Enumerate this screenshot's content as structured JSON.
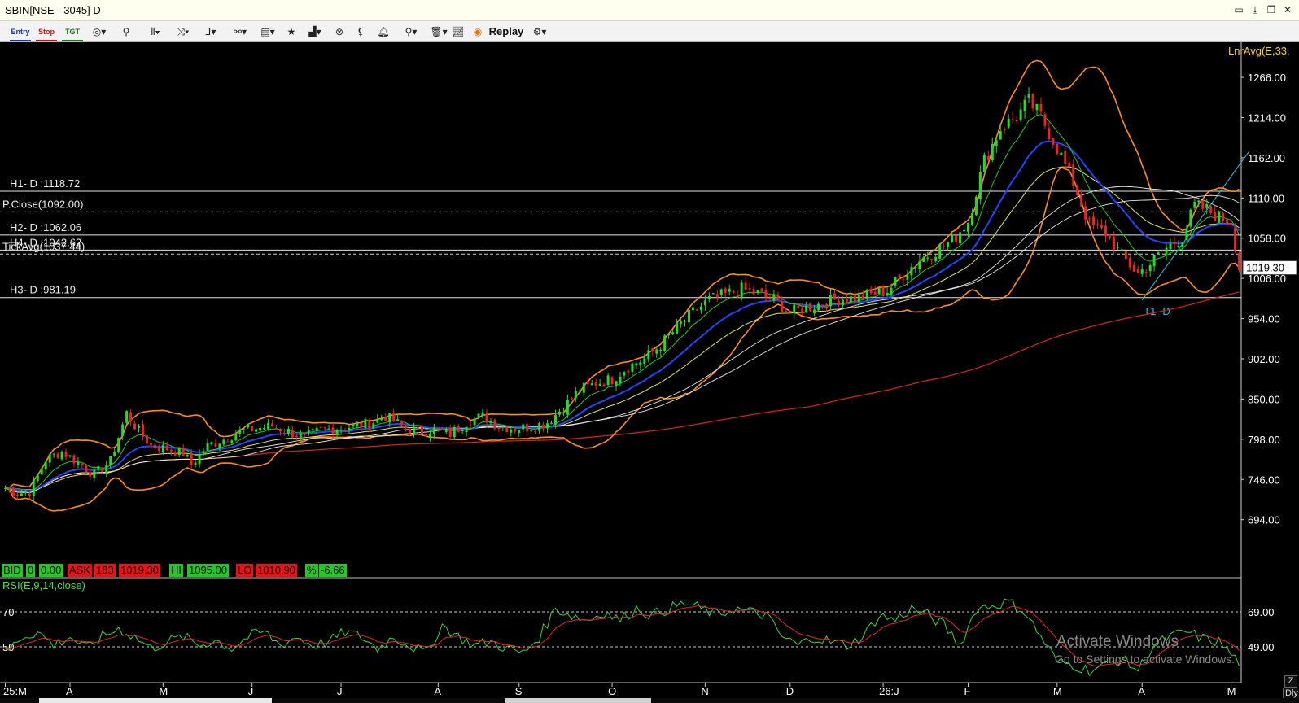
{
  "window": {
    "title": "SBIN[NSE - 3045] D",
    "controls": [
      "▭",
      "✕"
    ]
  },
  "toolbar": {
    "entry": "Entry",
    "stop": "Stop",
    "tgt": "TGT",
    "replay": "Replay"
  },
  "quote": {
    "bid_label": "BID",
    "bid_qty": "0",
    "bid_price": "0.00",
    "ask_label": "ASK",
    "ask_qty": "183",
    "ask_price": "1019.30",
    "hi_label": "HI",
    "hi": "1095.00",
    "lo_label": "LO",
    "lo": "1010.90",
    "pct_label": "%",
    "pct": "-6.66"
  },
  "rsi": {
    "label": "RSI(E,9,14,close)",
    "left_levels": [
      "70",
      "50"
    ],
    "right_levels": [
      "69.00",
      "49.00"
    ]
  },
  "watermark": {
    "line1": "Activate Windows",
    "line2": "Go to Settings to activate Windows."
  },
  "corner_buttons": {
    "zoom": "Z",
    "period": "Dly"
  },
  "colors": {
    "background": "#000000",
    "up_candle": "#22dd22",
    "down_candle": "#ee2222",
    "bollinger": "#ff8c1a",
    "ema_green": "#22cc22",
    "ema_blue": "#2244ff",
    "ema_yellow": "#e6e64d",
    "ma_white": "#e8e8e8",
    "ma_red": "#dd2222",
    "rsi_line": "#33dd33",
    "rsi_signal": "#ee2222",
    "trendline": "#1ec8e6"
  },
  "chart_data": {
    "type": "candlestick",
    "symbol": "SBIN[NSE - 3045] D",
    "top_legend": "LnrAvg(E,33,",
    "ylim": [
      640,
      1305
    ],
    "y_ticks": [
      "1266.00",
      "1214.00",
      "1162.00",
      "1110.00",
      "1058.00",
      "1006.00",
      "954.00",
      "902.00",
      "850.00",
      "798.00",
      "746.00",
      "694.00"
    ],
    "last_price": "1019.30",
    "x_ticks": [
      "25:M",
      "A",
      "M",
      "J",
      "J",
      "A",
      "S",
      "O",
      "N",
      "D",
      "26:J",
      "F",
      "M",
      "A",
      "M"
    ],
    "x_tick_positions": [
      0,
      16,
      39,
      61,
      83,
      107,
      127,
      150,
      173,
      194,
      217,
      238,
      260,
      281,
      303
    ],
    "bar_count": 306,
    "levels": [
      {
        "label": "H1- D :1118.72",
        "value": 1118.72
      },
      {
        "label": "P.Close(1092.00)",
        "value": 1092.0
      },
      {
        "label": "H2- D :1062.06",
        "value": 1062.06
      },
      {
        "label": "H4- D :1042.62",
        "value": 1042.62
      },
      {
        "label": "TickAvg(1037.44)",
        "value": 1037.44
      },
      {
        "label": "H3- D :981.19",
        "value": 981.19
      }
    ],
    "trendline": {
      "label": "T1- D",
      "from": [
        281,
        978
      ],
      "to": [
        305,
        1170
      ]
    },
    "price_anchors": [
      [
        0,
        735
      ],
      [
        3,
        728
      ],
      [
        6,
        730
      ],
      [
        10,
        772
      ],
      [
        14,
        782
      ],
      [
        18,
        768
      ],
      [
        22,
        752
      ],
      [
        26,
        770
      ],
      [
        30,
        832
      ],
      [
        33,
        808
      ],
      [
        36,
        790
      ],
      [
        40,
        786
      ],
      [
        44,
        780
      ],
      [
        46,
        765
      ],
      [
        50,
        790
      ],
      [
        54,
        798
      ],
      [
        58,
        808
      ],
      [
        62,
        812
      ],
      [
        66,
        815
      ],
      [
        70,
        808
      ],
      [
        74,
        800
      ],
      [
        78,
        810
      ],
      [
        82,
        812
      ],
      [
        86,
        815
      ],
      [
        90,
        818
      ],
      [
        94,
        828
      ],
      [
        98,
        815
      ],
      [
        102,
        808
      ],
      [
        106,
        810
      ],
      [
        110,
        805
      ],
      [
        114,
        820
      ],
      [
        118,
        828
      ],
      [
        122,
        815
      ],
      [
        126,
        812
      ],
      [
        130,
        814
      ],
      [
        134,
        820
      ],
      [
        138,
        840
      ],
      [
        142,
        862
      ],
      [
        146,
        870
      ],
      [
        150,
        876
      ],
      [
        154,
        892
      ],
      [
        158,
        902
      ],
      [
        162,
        920
      ],
      [
        166,
        942
      ],
      [
        170,
        962
      ],
      [
        174,
        978
      ],
      [
        178,
        985
      ],
      [
        182,
        992
      ],
      [
        186,
        986
      ],
      [
        190,
        978
      ],
      [
        194,
        962
      ],
      [
        198,
        968
      ],
      [
        202,
        974
      ],
      [
        206,
        980
      ],
      [
        210,
        980
      ],
      [
        214,
        985
      ],
      [
        218,
        990
      ],
      [
        222,
        1012
      ],
      [
        226,
        1030
      ],
      [
        230,
        1042
      ],
      [
        234,
        1055
      ],
      [
        238,
        1080
      ],
      [
        242,
        1158
      ],
      [
        246,
        1200
      ],
      [
        250,
        1215
      ],
      [
        253,
        1235
      ],
      [
        256,
        1215
      ],
      [
        260,
        1175
      ],
      [
        264,
        1130
      ],
      [
        268,
        1075
      ],
      [
        272,
        1065
      ],
      [
        276,
        1035
      ],
      [
        280,
        1012
      ],
      [
        283,
        1025
      ],
      [
        287,
        1045
      ],
      [
        291,
        1060
      ],
      [
        294,
        1100
      ],
      [
        297,
        1095
      ],
      [
        300,
        1085
      ],
      [
        303,
        1080
      ],
      [
        305,
        1019
      ]
    ],
    "rsi_anchors": [
      [
        0,
        45
      ],
      [
        4,
        55
      ],
      [
        8,
        58
      ],
      [
        12,
        50
      ],
      [
        16,
        55
      ],
      [
        20,
        48
      ],
      [
        24,
        55
      ],
      [
        28,
        60
      ],
      [
        32,
        55
      ],
      [
        36,
        48
      ],
      [
        40,
        52
      ],
      [
        44,
        55
      ],
      [
        48,
        50
      ],
      [
        52,
        53
      ],
      [
        56,
        48
      ],
      [
        60,
        55
      ],
      [
        64,
        58
      ],
      [
        68,
        50
      ],
      [
        72,
        55
      ],
      [
        76,
        50
      ],
      [
        80,
        52
      ],
      [
        84,
        58
      ],
      [
        88,
        55
      ],
      [
        92,
        48
      ],
      [
        96,
        55
      ],
      [
        100,
        50
      ],
      [
        104,
        45
      ],
      [
        108,
        62
      ],
      [
        112,
        55
      ],
      [
        116,
        50
      ],
      [
        120,
        52
      ],
      [
        124,
        48
      ],
      [
        128,
        45
      ],
      [
        132,
        55
      ],
      [
        136,
        72
      ],
      [
        140,
        68
      ],
      [
        144,
        65
      ],
      [
        148,
        70
      ],
      [
        152,
        65
      ],
      [
        156,
        72
      ],
      [
        160,
        68
      ],
      [
        164,
        72
      ],
      [
        168,
        75
      ],
      [
        172,
        72
      ],
      [
        176,
        68
      ],
      [
        180,
        72
      ],
      [
        184,
        70
      ],
      [
        188,
        68
      ],
      [
        192,
        55
      ],
      [
        196,
        50
      ],
      [
        200,
        55
      ],
      [
        204,
        52
      ],
      [
        208,
        50
      ],
      [
        212,
        55
      ],
      [
        216,
        68
      ],
      [
        220,
        65
      ],
      [
        224,
        72
      ],
      [
        228,
        68
      ],
      [
        232,
        62
      ],
      [
        236,
        50
      ],
      [
        240,
        72
      ],
      [
        244,
        74
      ],
      [
        248,
        76
      ],
      [
        252,
        70
      ],
      [
        256,
        55
      ],
      [
        260,
        40
      ],
      [
        264,
        38
      ],
      [
        268,
        35
      ],
      [
        272,
        38
      ],
      [
        276,
        42
      ],
      [
        280,
        35
      ],
      [
        284,
        50
      ],
      [
        288,
        55
      ],
      [
        292,
        58
      ],
      [
        296,
        54
      ],
      [
        300,
        52
      ],
      [
        304,
        42
      ],
      [
        305,
        40
      ]
    ]
  }
}
